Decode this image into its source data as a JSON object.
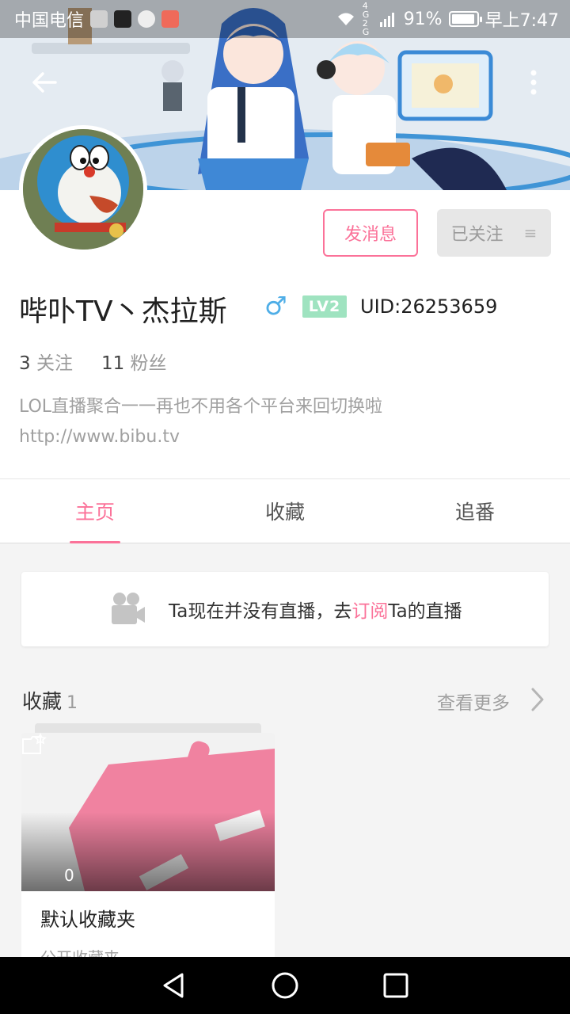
{
  "status_bar": {
    "carrier": "中国电信",
    "network": "4G 2G",
    "battery": "91%",
    "time": "早上7:47"
  },
  "profile": {
    "name": "哔卟TV丶杰拉斯",
    "gender_symbol": "♂",
    "level_badge": "LV2",
    "uid": "UID:26253659",
    "following_count": "3",
    "following_label": "关注",
    "followers_count": "11",
    "followers_label": "粉丝",
    "bio_line1": "LOL直播聚合一一再也不用各个平台来回切换啦",
    "bio_line2": "http://www.bibu.tv",
    "message_button": "发消息",
    "follow_button": "已关注",
    "follow_menu_glyph": "≡"
  },
  "tabs": [
    {
      "label": "主页",
      "active": true
    },
    {
      "label": "收藏",
      "active": false
    },
    {
      "label": "追番",
      "active": false
    }
  ],
  "live": {
    "text_before": "Ta现在并没有直播，去",
    "link": "订阅",
    "text_after": "Ta的直播"
  },
  "favorites": {
    "title": "收藏",
    "count": "1",
    "see_more": "查看更多",
    "folder": {
      "name": "默认收藏夹",
      "subtitle": "公开收藏夹",
      "item_count": "0"
    }
  },
  "colors": {
    "accent": "#fb7299",
    "gender": "#4faee7",
    "level": "#9fe3c0"
  },
  "icons": [
    "back-arrow-icon",
    "more-vert-icon",
    "camera-icon",
    "chevron-right-icon",
    "star-folder-icon",
    "nav-back-icon",
    "nav-home-icon",
    "nav-recents-icon"
  ]
}
